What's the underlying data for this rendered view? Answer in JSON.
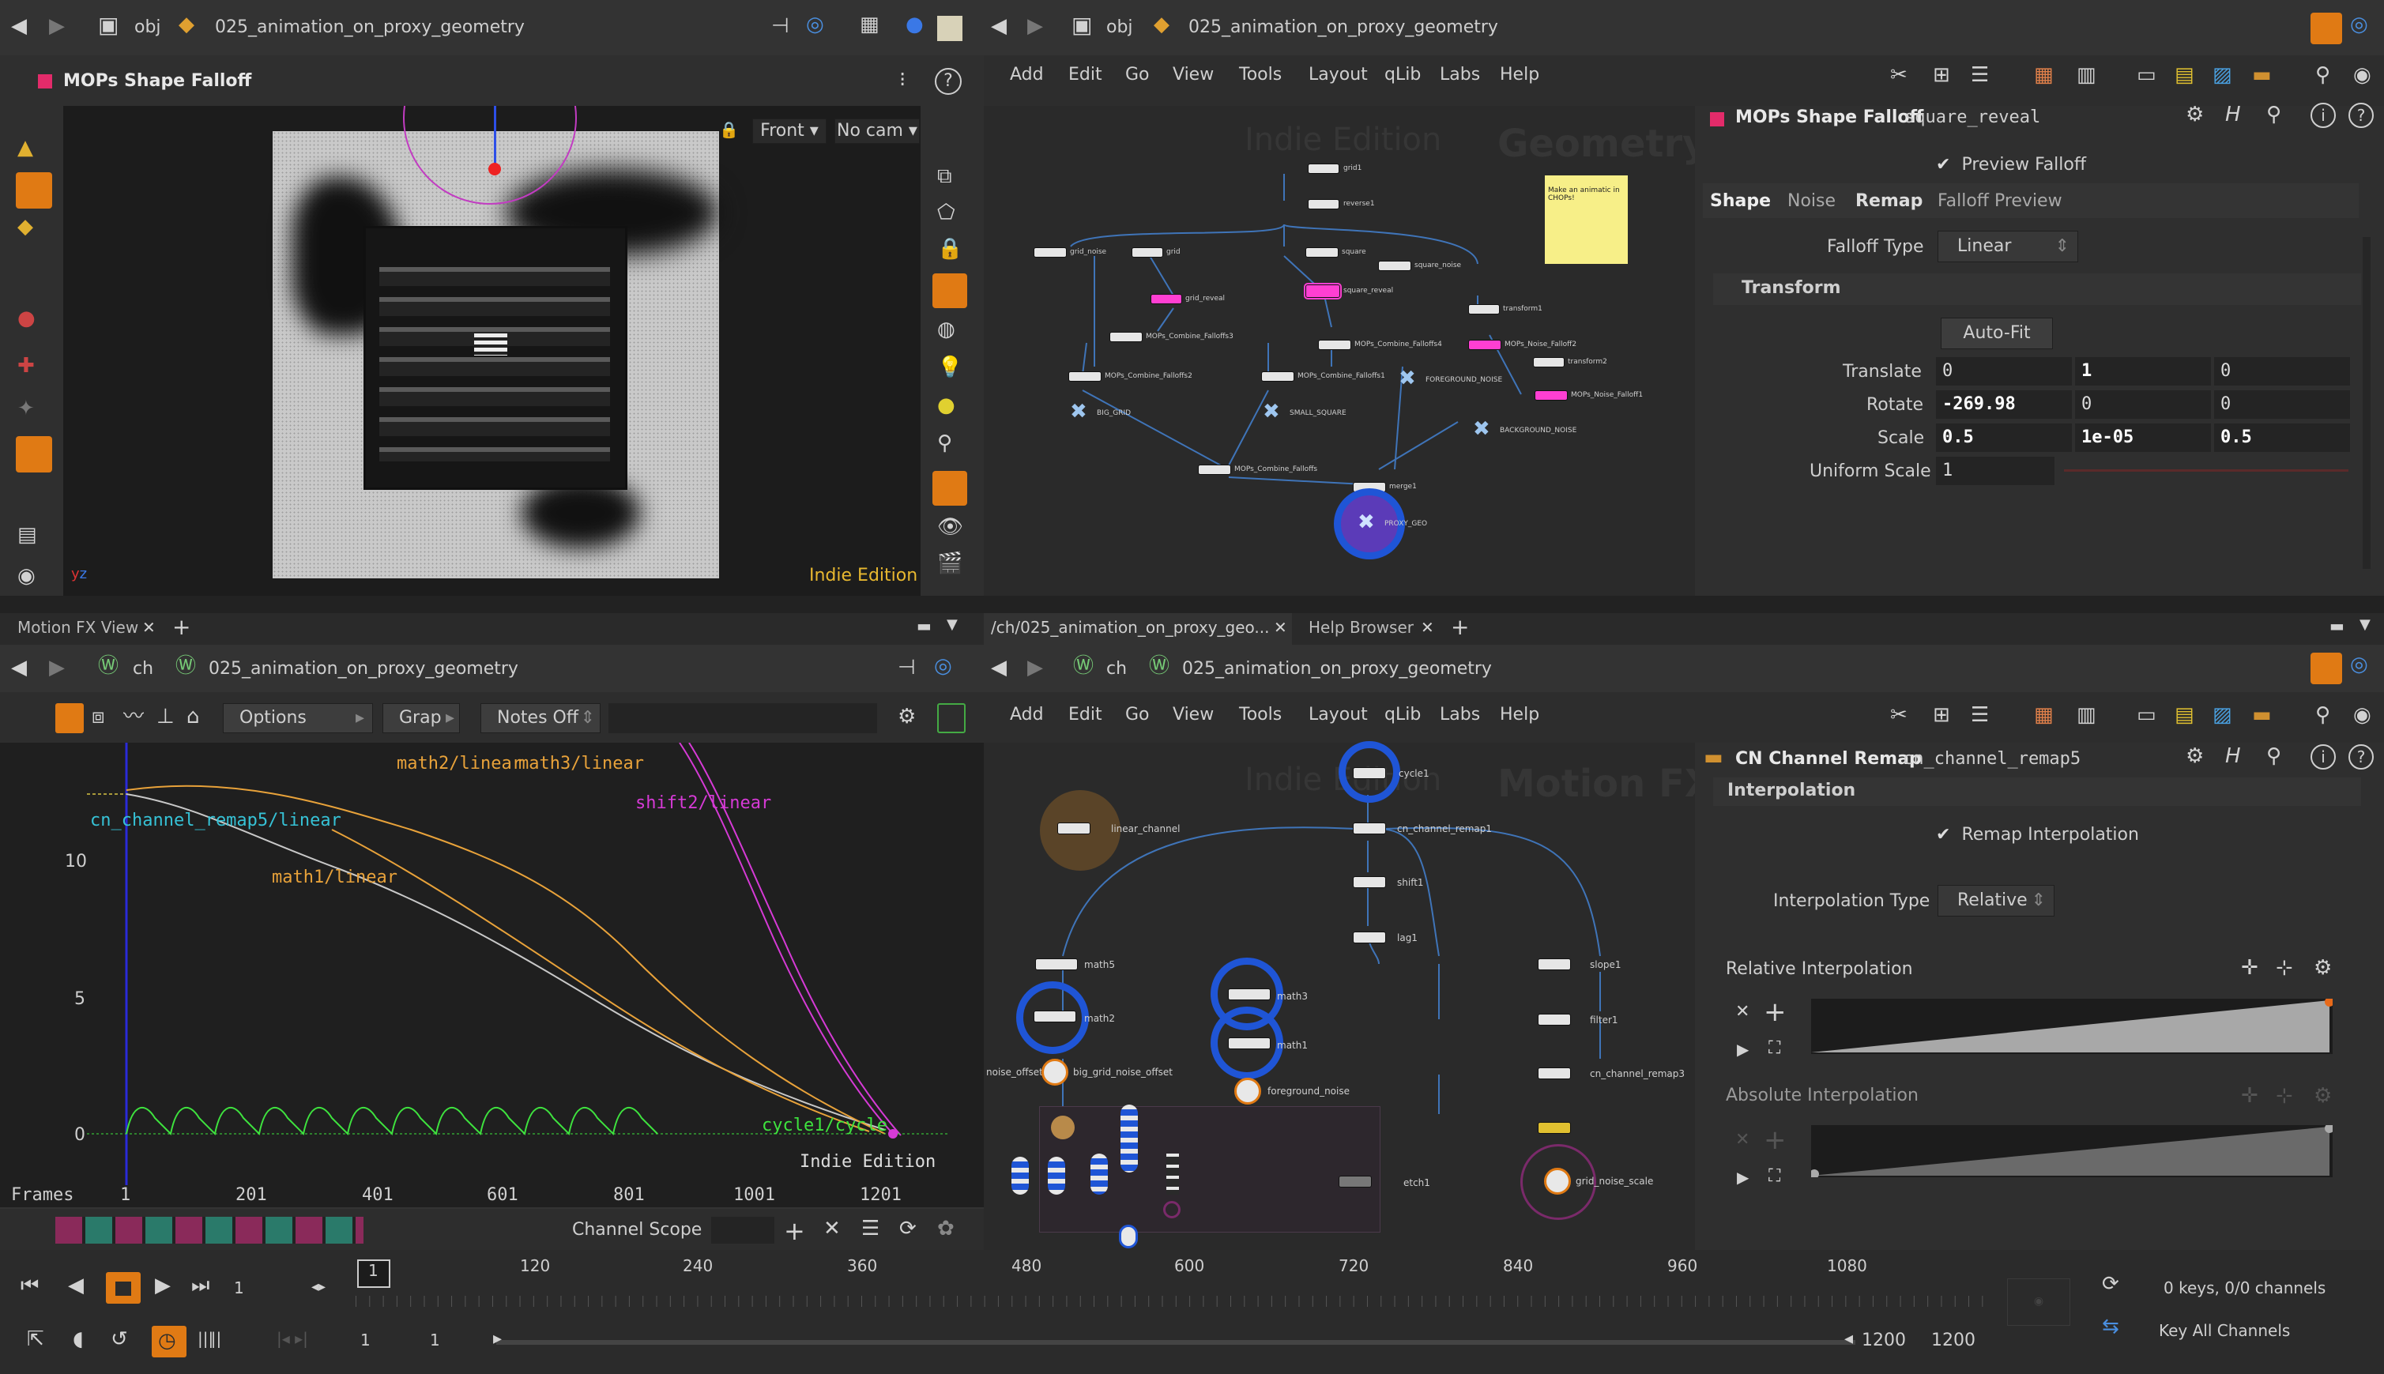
{
  "scene": {
    "tab_obj": "obj",
    "path": "025_animation_on_proxy_geometry",
    "viewport_title": "MOPs Shape Falloff",
    "view_front": "Front",
    "view_cam": "No cam",
    "watermark": "Indie Edition"
  },
  "network_top": {
    "tab_obj": "obj",
    "path": "025_animation_on_proxy_geometry",
    "menu": [
      "Add",
      "Edit",
      "Go",
      "View",
      "Tools",
      "Layout",
      "qLib",
      "Labs",
      "Help"
    ],
    "watermark_indie": "Indie Edition",
    "watermark_context": "Geometry",
    "sticky_note": "Make an animatic in CHOPs!",
    "nodes": [
      {
        "label": "grid1"
      },
      {
        "label": "reverse1"
      },
      {
        "label": "grid_noise"
      },
      {
        "label": "grid"
      },
      {
        "label": "grid_reveal"
      },
      {
        "label": "square"
      },
      {
        "label": "square_noise"
      },
      {
        "label": "square_reveal"
      },
      {
        "label": "transform1"
      },
      {
        "label": "MOPs_Combine_Falloffs3"
      },
      {
        "label": "MOPs_Combine_Falloffs4"
      },
      {
        "label": "MOPs_Noise_Falloff2"
      },
      {
        "label": "transform2"
      },
      {
        "label": "MOPs_Combine_Falloffs2"
      },
      {
        "label": "MOPs_Combine_Falloffs1"
      },
      {
        "label": "FOREGROUND_NOISE"
      },
      {
        "label": "MOPs_Noise_Falloff1"
      },
      {
        "label": "BIG_GRID"
      },
      {
        "label": "SMALL_SQUARE"
      },
      {
        "label": "BACKGROUND_NOISE"
      },
      {
        "label": "MOPs_Combine_Falloffs"
      },
      {
        "label": "merge1"
      },
      {
        "label": "PROXY_GEO"
      }
    ]
  },
  "params_top": {
    "node_type": "MOPs Shape Falloff",
    "node_name": "square_reveal",
    "preview_falloff": "Preview Falloff",
    "tabs": [
      "Shape",
      "Noise",
      "Remap",
      "Falloff Preview"
    ],
    "falloff_type_label": "Falloff Type",
    "falloff_type_value": "Linear",
    "transform_label": "Transform",
    "auto_fit": "Auto-Fit",
    "translate_label": "Translate",
    "translate": [
      "0",
      "1",
      "0"
    ],
    "rotate_label": "Rotate",
    "rotate": [
      "-269.98",
      "0",
      "0"
    ],
    "scale_label": "Scale",
    "scale": [
      "0.5",
      "1e-05",
      "0.5"
    ],
    "uniform_scale_label": "Uniform Scale",
    "uniform_scale": "1"
  },
  "motionfx": {
    "tab": "Motion FX View",
    "tab_ch": "ch",
    "path": "025_animation_on_proxy_geometry",
    "options": "Options",
    "graph": "Grap",
    "notes": "Notes Off",
    "curve_labels": [
      "math2/linear",
      "math3/linear",
      "shift2/linear",
      "cn_channel_remap5/linear",
      "math1/linear",
      "cycle1/cycle"
    ],
    "y_ticks": [
      "10",
      "5",
      "0"
    ],
    "x_unit": "Frames",
    "x_ticks": [
      "1",
      "201",
      "401",
      "601",
      "801",
      "1001",
      "1201"
    ],
    "watermark": "Indie Edition",
    "channel_scope": "Channel Scope"
  },
  "network_bottom": {
    "tab_path": "/ch/025_animation_on_proxy_geo...",
    "tab_help": "Help Browser",
    "tab_ch": "ch",
    "path": "025_animation_on_proxy_geometry",
    "menu": [
      "Add",
      "Edit",
      "Go",
      "View",
      "Tools",
      "Layout",
      "qLib",
      "Labs",
      "Help"
    ],
    "watermark_indie": "Indie Edition",
    "watermark_context": "Motion FX",
    "nodes": [
      {
        "label": "cycle1"
      },
      {
        "label": "linear_channel"
      },
      {
        "label": "cn_channel_remap1"
      },
      {
        "label": "shift1"
      },
      {
        "label": "lag1"
      },
      {
        "label": "math5"
      },
      {
        "label": "slope1"
      },
      {
        "label": "math2"
      },
      {
        "label": "math3"
      },
      {
        "label": "filter1"
      },
      {
        "label": "math1"
      },
      {
        "label": "noise_offset"
      },
      {
        "label": "big_grid_noise_offset"
      },
      {
        "label": "foreground_noise"
      },
      {
        "label": "cn_channel_remap3"
      },
      {
        "label": "etch1"
      },
      {
        "label": "grid_noise_scale"
      }
    ]
  },
  "params_bottom": {
    "node_type": "CN Channel Remap",
    "node_name": "cn_channel_remap5",
    "section": "Interpolation",
    "remap_interp": "Remap Interpolation",
    "interp_type_label": "Interpolation Type",
    "interp_type_value": "Relative",
    "relative_label": "Relative Interpolation",
    "absolute_label": "Absolute Interpolation"
  },
  "timeline": {
    "frame": "1",
    "ticks": [
      "120",
      "240",
      "360",
      "480",
      "600",
      "720",
      "840",
      "960",
      "1080"
    ],
    "current": "1",
    "start": "1",
    "start2": "1",
    "end": "1200",
    "end2": "1200",
    "keys": "0 keys, 0/0 channels",
    "key_all": "Key All Channels"
  },
  "colors": {
    "accent_orange": "#ff8a00",
    "selected_pink": "#ff3fd2",
    "ring_blue": "#1f55d6",
    "curve_green": "#3ee33e",
    "curve_orange": "#e8a23a",
    "curve_magenta": "#d63ad6"
  }
}
